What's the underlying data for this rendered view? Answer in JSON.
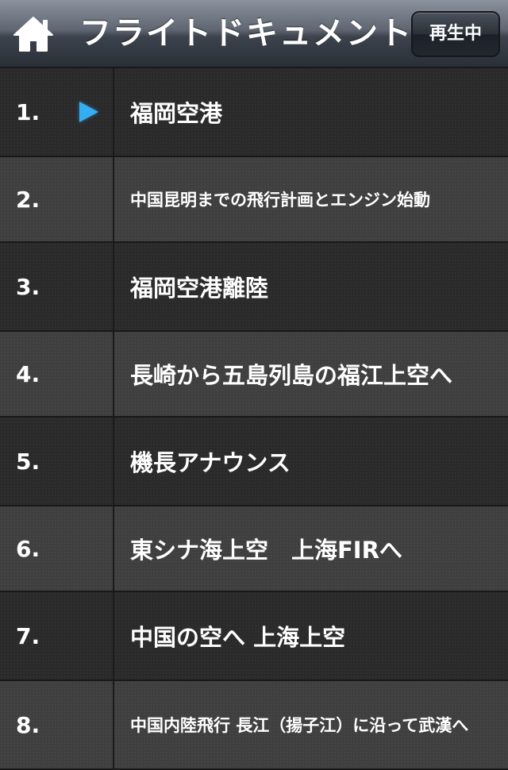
{
  "navbar": {
    "title": "フライトドキュメント",
    "playing_label": "再生中",
    "home_icon": "home-icon"
  },
  "colors": {
    "play_indicator": "#33aef2",
    "row_dark": "#2a2a2a",
    "row_light": "#3f3f3f",
    "text": "#ffffff"
  },
  "tracks": [
    {
      "num": "1.",
      "title": "福岡空港",
      "playing": true
    },
    {
      "num": "2.",
      "title": "中国昆明までの飛行計画とエンジン始動",
      "playing": false
    },
    {
      "num": "3.",
      "title": "福岡空港離陸",
      "playing": false
    },
    {
      "num": "4.",
      "title": "長崎から五島列島の福江上空へ",
      "playing": false
    },
    {
      "num": "5.",
      "title": "機長アナウンス",
      "playing": false
    },
    {
      "num": "6.",
      "title": "東シナ海上空　上海FIRへ",
      "playing": false
    },
    {
      "num": "7.",
      "title": "中国の空へ 上海上空",
      "playing": false
    },
    {
      "num": "8.",
      "title": "中国内陸飛行 長江（揚子江）に沿って武漢へ",
      "playing": false
    }
  ]
}
